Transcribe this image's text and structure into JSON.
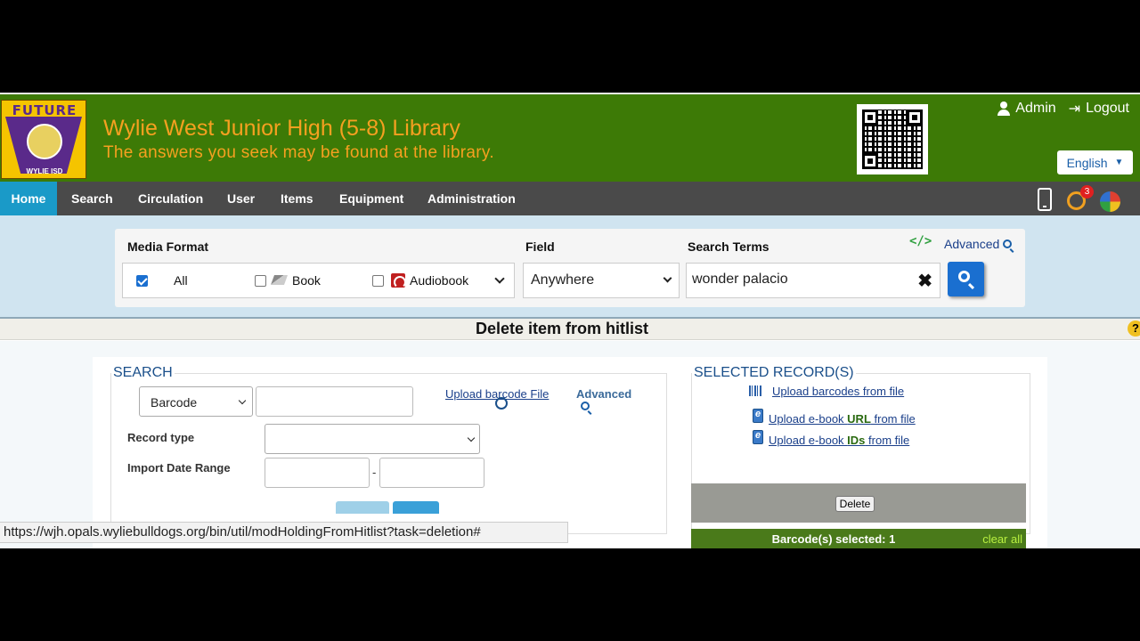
{
  "header": {
    "logo_top": "FUTURE",
    "logo_bottom": "WYLIE ISD",
    "title": "Wylie West Junior High (5-8) Library",
    "tagline": "The answers you seek may be found at the library.",
    "admin_label": "Admin",
    "logout_label": "Logout",
    "language": "English"
  },
  "nav": {
    "items": [
      "Home",
      "Search",
      "Circulation",
      "User",
      "Items",
      "Equipment",
      "Administration"
    ],
    "notification_count": "3"
  },
  "search_panel": {
    "media_format_label": "Media Format",
    "field_label": "Field",
    "terms_label": "Search Terms",
    "advanced_label": "Advanced",
    "formats": [
      "All",
      "Book",
      "Audiobook"
    ],
    "field_value": "Anywhere",
    "terms_value": "wonder palacio"
  },
  "page_title": "Delete item from hitlist",
  "search_section": {
    "legend": "SEARCH",
    "search_by": "Barcode",
    "upload_link": "Upload barcode File",
    "advanced": "Advanced",
    "record_type_label": "Record type",
    "import_date_label": "Import Date Range",
    "date_sep": "-"
  },
  "selected_section": {
    "legend": "SELECTED RECORD(S)",
    "upload_barcodes": "Upload barcodes from file",
    "upload_url_pre": "Upload e-book ",
    "upload_url_bold": "URL",
    "upload_url_post": " from file",
    "upload_ids_pre": "Upload e-book ",
    "upload_ids_bold": "IDs",
    "upload_ids_post": " from file",
    "delete_label": "Delete",
    "selected_count": "Barcode(s) selected: 1",
    "clear_all": "clear all"
  },
  "status_url": "https://wjh.opals.wyliebulldogs.org/bin/util/modHoldingFromHitlist?task=deletion#"
}
